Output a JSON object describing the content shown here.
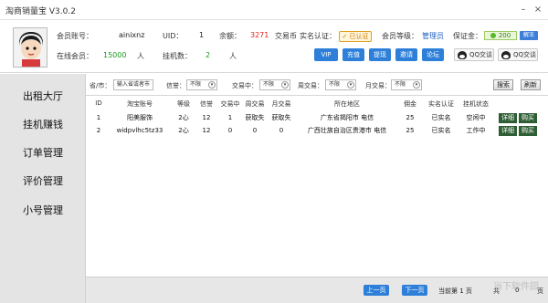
{
  "window": {
    "title": "淘商销量宝 V3.0.2",
    "min_glyph": "–",
    "close_glyph": "×"
  },
  "header": {
    "account_label": "会员账号：",
    "account_value": "ainixnz",
    "uid_label": "UID：",
    "uid_value": "1",
    "balance_label": "余额：",
    "balance_value": "3271",
    "currency_label": "交易币",
    "realname_label": "实名认证：",
    "realname_badge": "已认证",
    "level_label": "会员等级：",
    "level_value": "管理员",
    "deposit_label": "保证金：",
    "deposit_value": "200",
    "unfreeze_label": "解冻",
    "online_label": "在线会员：",
    "online_value": "15000",
    "online_unit": "人",
    "hosted_label": "挂机数：",
    "hosted_value": "2",
    "hosted_unit": "人",
    "buttons": [
      "VIP",
      "充值",
      "提现",
      "邀请",
      "论坛"
    ],
    "qq1": "QQ交谈",
    "qq2": "QQ交谈"
  },
  "sidebar": {
    "items": [
      "出租大厅",
      "挂机赚钱",
      "订单管理",
      "评价管理",
      "小号管理"
    ]
  },
  "filter": {
    "region_label": "省/市：",
    "region_placeholder": "输入省或者市",
    "credit_label": "信誉：",
    "credit_value": "不限",
    "trading_label": "交易中：",
    "trading_value": "不限",
    "weekly_label": "周交易：",
    "weekly_value": "不限",
    "monthly_label": "月交易：",
    "monthly_value": "不限",
    "search_label": "搜索",
    "refresh_label": "刷新"
  },
  "table": {
    "headers": [
      "ID",
      "淘宝账号",
      "等级",
      "信誉",
      "交易中",
      "周交易",
      "月交易",
      "所在地区",
      "佣金",
      "实名认证",
      "挂机状态"
    ],
    "rows": [
      {
        "id": "1",
        "account": "阳美服饰",
        "level": "2心",
        "credit": "12",
        "trading": "1",
        "weekly": "获取失",
        "monthly": "获取失",
        "region": "广东省揭阳市 电信",
        "commission": "25",
        "realname": "已实名",
        "status": "空闲中",
        "detail": "详细",
        "buy": "购买"
      },
      {
        "id": "2",
        "account": "widpvlhc5tz33",
        "level": "2心",
        "credit": "12",
        "trading": "0",
        "weekly": "0",
        "monthly": "0",
        "region": "广西壮族自治区贵港市 电信",
        "commission": "25",
        "realname": "已实名",
        "status": "工作中",
        "detail": "详细",
        "buy": "购买"
      }
    ]
  },
  "footer": {
    "prev_label": "上一页",
    "next_label": "下一页",
    "page_text": "当前第 1 页",
    "total_prefix": "共",
    "total_value": "0",
    "total_suffix": "页"
  },
  "watermark": "当下软件园"
}
